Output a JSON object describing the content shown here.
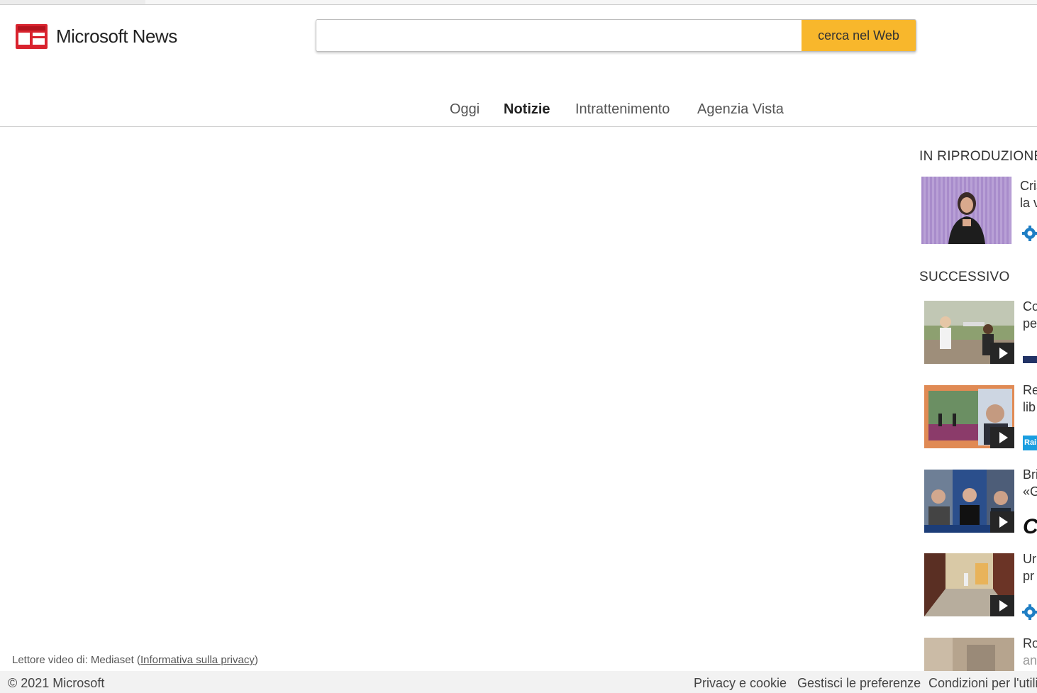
{
  "brand": {
    "name": "Microsoft News",
    "accent": "#d9232e"
  },
  "search": {
    "placeholder": "",
    "value": "",
    "button_label": "cerca nel Web",
    "button_color": "#f8b72c"
  },
  "nav": {
    "tabs": [
      {
        "label": "Oggi",
        "active": false
      },
      {
        "label": "Notizie",
        "active": true
      },
      {
        "label": "Intrattenimento",
        "active": false
      },
      {
        "label": "Agenzia Vista",
        "active": false
      }
    ]
  },
  "sidebar": {
    "now_playing_heading": "IN RIPRODUZIONE",
    "now_playing": {
      "title_lines": [
        "Cris",
        "la v"
      ],
      "source_icon": "gear-icon"
    },
    "next_heading": "SUCCESSIVO",
    "next_items": [
      {
        "title_lines": [
          "Co",
          "pe"
        ],
        "source_icon": "source-logo-tiny"
      },
      {
        "title_lines": [
          "Re",
          "lib"
        ],
        "source_icon": "rai-logo",
        "source_text": "Rai"
      },
      {
        "title_lines": [
          "Bri",
          "«G"
        ],
        "source_icon": "c-logo",
        "source_text": "C"
      },
      {
        "title_lines": [
          "Ur",
          "pr"
        ],
        "source_icon": "gear-icon"
      },
      {
        "title_lines": [
          "Ro",
          "an"
        ],
        "source_icon": ""
      }
    ]
  },
  "player_credit": {
    "prefix": "Lettore video di: Mediaset (",
    "link": "Informativa sulla privacy",
    "suffix": ")"
  },
  "footer": {
    "copyright": "© 2021 Microsoft",
    "links": [
      "Privacy e cookie",
      "Gestisci le preferenze",
      "Condizioni per l'utili"
    ]
  }
}
